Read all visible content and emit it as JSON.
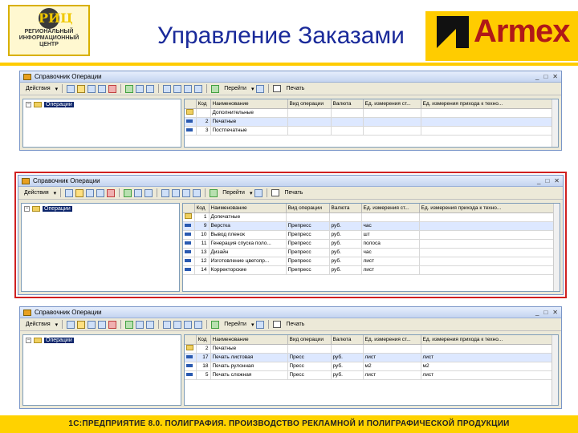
{
  "header": {
    "logo_lines": [
      "РЕГИОНАЛЬНЫЙ",
      "ИНФОРМАЦИОННЫЙ",
      "ЦЕНТР"
    ],
    "logo_badge": "РИЦ",
    "title": "Управление Заказами",
    "brand": "Armex"
  },
  "footer": {
    "text": "1С:ПРЕДПРИЯТИЕ 8.0. ПОЛИГРАФИЯ. ПРОИЗВОДСТВО РЕКЛАМНОЙ И ПОЛИГРАФИЧЕСКОЙ ПРОДУКЦИИ"
  },
  "toolbar": {
    "actions": "Действия",
    "goto": "Перейти",
    "print": "Печать"
  },
  "colors": {
    "accent_yellow": "#ffcc00",
    "brand_red": "#b01818",
    "title_blue": "#1a2a9a",
    "highlight_red": "#d02020"
  },
  "windows": [
    {
      "title": "Справочник Операции",
      "tree_label": "Операции",
      "columns": [
        "",
        "Код",
        "Наименование",
        "Вид операции",
        "Валюта",
        "Ед. измерения ст...",
        "Ед. измерения прихода к техно..."
      ],
      "rows": [
        [
          "",
          "",
          "Дополнительные",
          "",
          "",
          "",
          ""
        ],
        [
          "",
          "2",
          "Печатные",
          "",
          "",
          "",
          ""
        ],
        [
          "",
          "3",
          "Постпечатные",
          "",
          "",
          "",
          ""
        ]
      ]
    },
    {
      "title": "Справочник Операции",
      "tree_label": "Операции",
      "columns": [
        "",
        "Код",
        "Наименование",
        "Вид операции",
        "Валюта",
        "Ед. измерения ст...",
        "Ед. измерения прихода к техно..."
      ],
      "rows": [
        [
          "",
          "1",
          "Допечатные",
          "",
          "",
          "",
          ""
        ],
        [
          "",
          "9",
          "Верстка",
          "Препресс",
          "руб.",
          "час",
          ""
        ],
        [
          "",
          "10",
          "Вывод пленок",
          "Препресс",
          "руб.",
          "шт",
          ""
        ],
        [
          "",
          "11",
          "Генерация спуска поло...",
          "Препресс",
          "руб.",
          "полоса",
          ""
        ],
        [
          "",
          "13",
          "Дизайн",
          "Препресс",
          "руб.",
          "час",
          ""
        ],
        [
          "",
          "12",
          "Изготовление цветопр...",
          "Препресс",
          "руб.",
          "лист",
          ""
        ],
        [
          "",
          "14",
          "Корректорские",
          "Препресс",
          "руб.",
          "лист",
          ""
        ]
      ]
    },
    {
      "title": "Справочник Операции",
      "tree_label": "Операции",
      "columns": [
        "",
        "Код",
        "Наименование",
        "Вид операции",
        "Валюта",
        "Ед. измерения ст...",
        "Ед. измерения прихода к техно..."
      ],
      "rows": [
        [
          "",
          "2",
          "Печатные",
          "",
          "",
          "",
          ""
        ],
        [
          "",
          "17",
          "Печать листовая",
          "Пресс",
          "руб.",
          "лист",
          "лист"
        ],
        [
          "",
          "18",
          "Печать рулонная",
          "Пресс",
          "руб.",
          "м2",
          "м2"
        ],
        [
          "",
          "5",
          "Печать сложная",
          "Пресс",
          "руб.",
          "лист",
          "лист"
        ]
      ]
    }
  ]
}
